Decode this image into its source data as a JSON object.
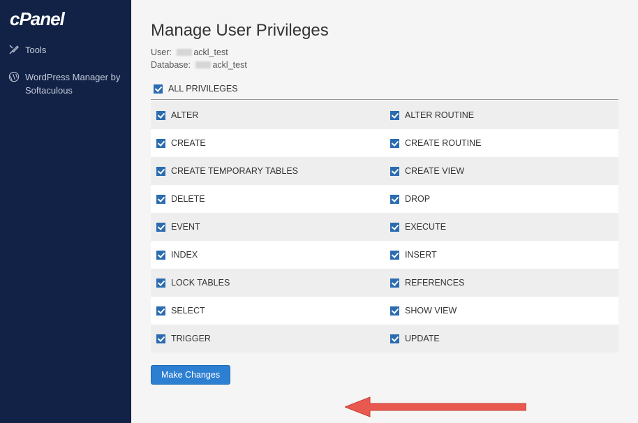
{
  "brand": "cPanel",
  "sidebar": {
    "items": [
      {
        "label": "Tools",
        "icon": "tools"
      },
      {
        "label": "WordPress Manager by Softaculous",
        "icon": "wordpress"
      }
    ]
  },
  "page": {
    "title": "Manage User Privileges",
    "user_label": "User:",
    "user_value": "ackl_test",
    "database_label": "Database:",
    "database_value": "ackl_test",
    "all_privileges_label": "ALL PRIVILEGES",
    "submit_label": "Make Changes"
  },
  "privileges": [
    {
      "left": "ALTER",
      "right": "ALTER ROUTINE"
    },
    {
      "left": "CREATE",
      "right": "CREATE ROUTINE"
    },
    {
      "left": "CREATE TEMPORARY TABLES",
      "right": "CREATE VIEW"
    },
    {
      "left": "DELETE",
      "right": "DROP"
    },
    {
      "left": "EVENT",
      "right": "EXECUTE"
    },
    {
      "left": "INDEX",
      "right": "INSERT"
    },
    {
      "left": "LOCK TABLES",
      "right": "REFERENCES"
    },
    {
      "left": "SELECT",
      "right": "SHOW VIEW"
    },
    {
      "left": "TRIGGER",
      "right": "UPDATE"
    }
  ]
}
